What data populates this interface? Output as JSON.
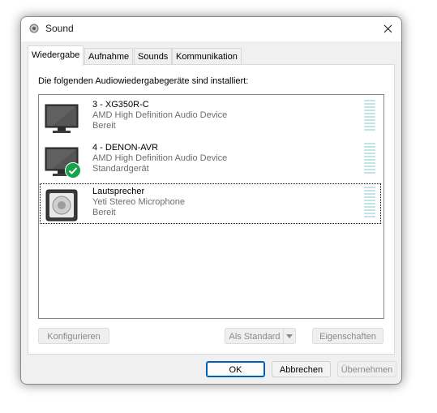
{
  "window": {
    "title": "Sound",
    "title_icon": "speaker-icon",
    "close_icon": "close-icon"
  },
  "tabs": [
    {
      "label": "Wiedergabe",
      "active": true
    },
    {
      "label": "Aufnahme",
      "active": false
    },
    {
      "label": "Sounds",
      "active": false
    },
    {
      "label": "Kommunikation",
      "active": false
    }
  ],
  "playback": {
    "instruction": "Die folgenden Audiowiedergabegeräte sind installiert:",
    "devices": [
      {
        "name": "3 - XG350R-C",
        "description": "AMD High Definition Audio Device",
        "status": "Bereit",
        "icon": "monitor-icon",
        "default": false,
        "selected": false
      },
      {
        "name": "4 - DENON-AVR",
        "description": "AMD High Definition Audio Device",
        "status": "Standardgerät",
        "icon": "monitor-icon",
        "default": true,
        "selected": false
      },
      {
        "name": "Lautsprecher",
        "description": "Yeti Stereo Microphone",
        "status": "Bereit",
        "icon": "speaker-box-icon",
        "default": false,
        "selected": true
      }
    ],
    "buttons": {
      "configure": "Konfigurieren",
      "set_default": "Als Standard",
      "properties": "Eigenschaften"
    }
  },
  "footer": {
    "ok": "OK",
    "cancel": "Abbrechen",
    "apply": "Übernehmen"
  },
  "colors": {
    "accent": "#005fb8",
    "check_green": "#16a34a",
    "meter": "#c3e3ea"
  }
}
